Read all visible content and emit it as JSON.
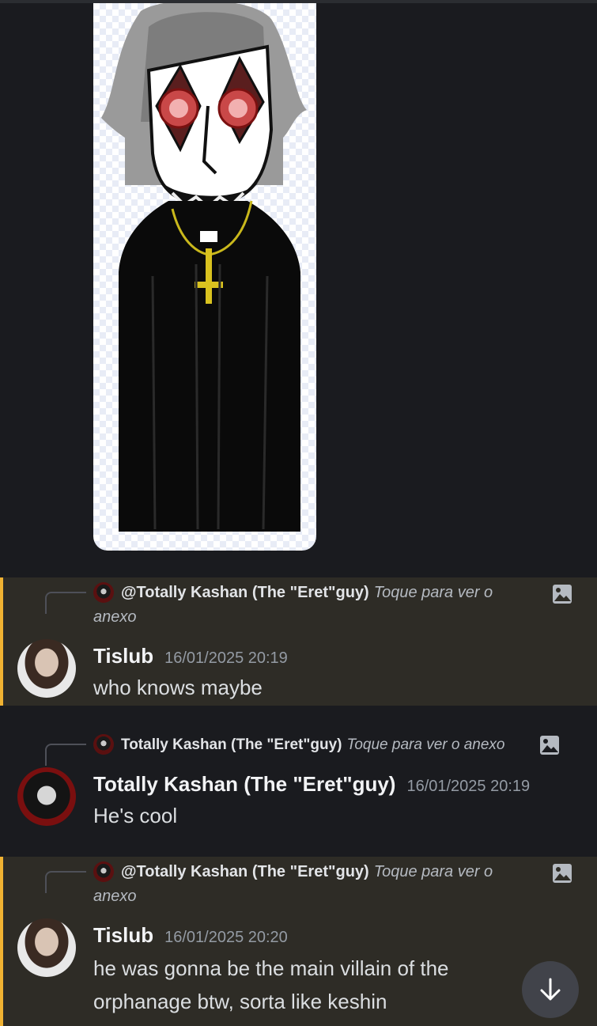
{
  "attachment": {
    "icon": "image-attachment"
  },
  "messages": [
    {
      "reply": {
        "name": "@Totally Kashan (The \"Eret\"guy)",
        "hint": "Toque para ver o anexo"
      },
      "author": "Tislub",
      "timestamp": "16/01/2025 20:19",
      "content": "who knows maybe",
      "mentioned": true
    },
    {
      "reply": {
        "name": "Totally Kashan (The \"Eret\"guy)",
        "hint": "Toque para ver o anexo"
      },
      "author": "Totally Kashan (The \"Eret\"guy)",
      "timestamp": "16/01/2025 20:19",
      "content": "He's cool",
      "mentioned": false
    },
    {
      "reply": {
        "name": "@Totally Kashan (The \"Eret\"guy)",
        "hint": "Toque para ver o anexo"
      },
      "author": "Tislub",
      "timestamp": "16/01/2025 20:20",
      "content": "he was gonna be the main villain of the orphanage btw, sorta like keshin",
      "mentioned": true
    }
  ],
  "colors": {
    "mention_bar": "#f0b232",
    "mention_bg": "#2e2c26",
    "background": "#1a1b1f"
  },
  "icons": [
    "image-icon",
    "arrow-down-icon"
  ]
}
